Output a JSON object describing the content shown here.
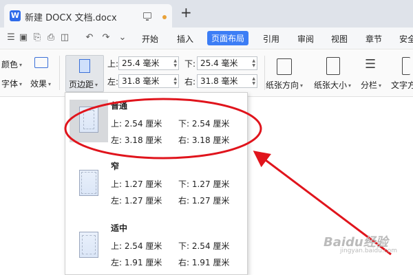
{
  "titlebar": {
    "doc_title": "新建 DOCX 文档.docx",
    "app_badge": "W",
    "new_tab": "+"
  },
  "menu": {
    "items": [
      "开始",
      "插入",
      "页面布局",
      "引用",
      "审阅",
      "视图",
      "章节",
      "安全"
    ],
    "active": "页面布局"
  },
  "ribbon": {
    "color_label": "颜色",
    "font_label": "字体",
    "effect_label": "效果",
    "margin_label": "页边距",
    "fields": {
      "top_label": "上:",
      "top_value": "25.4 毫米",
      "bottom_label": "下:",
      "bottom_value": "25.4 毫米",
      "left_label": "左:",
      "left_value": "31.8 毫米",
      "right_label": "右:",
      "right_value": "31.8 毫米"
    },
    "orientation_label": "纸张方向",
    "size_label": "纸张大小",
    "columns_label": "分栏",
    "text_dir_label": "文字方"
  },
  "margin_presets": [
    {
      "name": "普通",
      "top": "上: 2.54 厘米",
      "bottom": "下: 2.54 厘米",
      "left": "左: 3.18 厘米",
      "right": "右: 3.18 厘米",
      "selected": true
    },
    {
      "name": "窄",
      "top": "上: 1.27 厘米",
      "bottom": "下: 1.27 厘米",
      "left": "左: 1.27 厘米",
      "right": "右: 1.27 厘米",
      "selected": false
    },
    {
      "name": "适中",
      "top": "上: 2.54 厘米",
      "bottom": "下: 2.54 厘米",
      "left": "左: 1.91 厘米",
      "right": "右: 1.91 厘米",
      "selected": false
    }
  ],
  "watermark": {
    "text": "Baidu经验",
    "url": "jingyan.baidu.com"
  },
  "colors": {
    "accent": "#3c7df5",
    "annotation": "#e0141c"
  }
}
